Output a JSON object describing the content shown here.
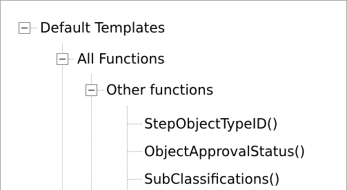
{
  "tree": {
    "root": {
      "label": "Default Templates",
      "expanded": true,
      "toggle_icon": "minus-box-icon"
    },
    "group": {
      "label": "All Functions",
      "expanded": true,
      "toggle_icon": "minus-box-icon"
    },
    "subgroup": {
      "label": "Other functions",
      "expanded": true,
      "toggle_icon": "minus-box-icon"
    },
    "items": [
      {
        "label": "StepObjectTypeID()"
      },
      {
        "label": "ObjectApprovalStatus()"
      },
      {
        "label": "SubClassifications()"
      }
    ]
  }
}
